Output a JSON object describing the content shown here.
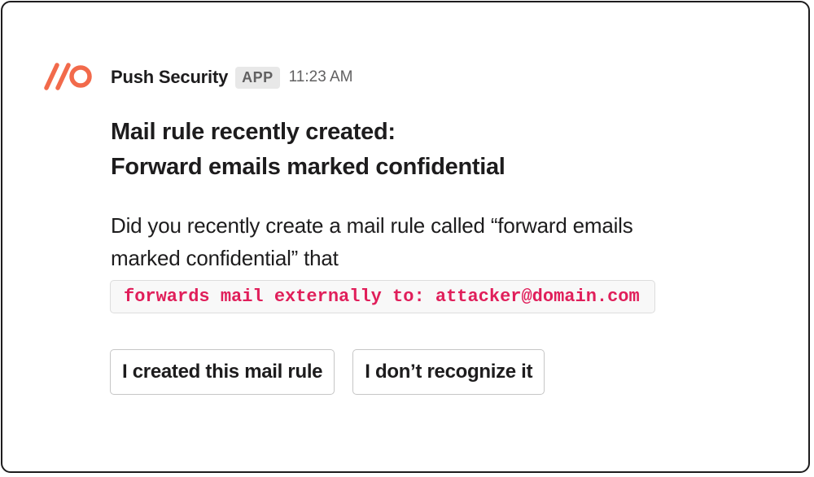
{
  "message": {
    "sender": "Push Security",
    "badge": "APP",
    "timestamp": "11:23 AM",
    "title_line1": "Mail rule recently created:",
    "title_line2": "Forward emails marked confidential",
    "body_line1": "Did you recently create a mail rule called “forward emails",
    "body_line2": "marked confidential” that",
    "code": "forwards mail externally to: attacker@domain.com"
  },
  "actions": {
    "confirm_label": "I created this mail rule",
    "deny_label": "I don’t recognize it"
  },
  "colors": {
    "brand_accent": "#f26a4b",
    "code_text": "#e01e5a",
    "text": "#1d1c1d",
    "muted": "#616061"
  },
  "icons": {
    "logo": "push-security-logo-icon"
  }
}
